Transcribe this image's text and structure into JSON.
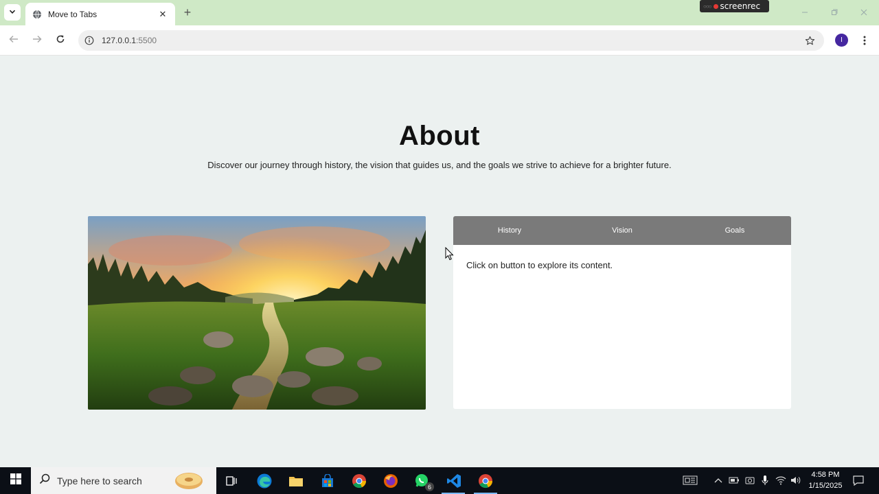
{
  "browser": {
    "tab_title": "Move to Tabs",
    "url_host": "127.0.0.1",
    "url_port": ":5500",
    "profile_initial": "I",
    "new_tab_label": "+",
    "close_tab_label": "✕",
    "recorder_label": "screenrec"
  },
  "page": {
    "title": "About",
    "subtitle": "Discover our journey through history, the vision that guides us, and the goals we strive to achieve for a brighter future.",
    "tabs": [
      {
        "label": "History"
      },
      {
        "label": "Vision"
      },
      {
        "label": "Goals"
      }
    ],
    "content_text": "Click on button to explore its content."
  },
  "taskbar": {
    "search_placeholder": "Type here to search",
    "whatsapp_badge": "6",
    "time": "4:58 PM",
    "date": "1/15/2025"
  },
  "colors": {
    "tab_strip": "#cfe9c6",
    "page_bg": "#ecf1f0",
    "tab_header": "#7a7a7a",
    "taskbar": "#0b0f16",
    "profile": "#4527a0"
  },
  "icons": {
    "tab_menu": "chevron-down-icon",
    "favicon": "globe-icon",
    "back": "arrow-left-icon",
    "forward": "arrow-right-icon",
    "reload": "reload-icon",
    "site_info": "info-icon",
    "bookmark": "star-icon",
    "menu": "kebab-icon"
  }
}
